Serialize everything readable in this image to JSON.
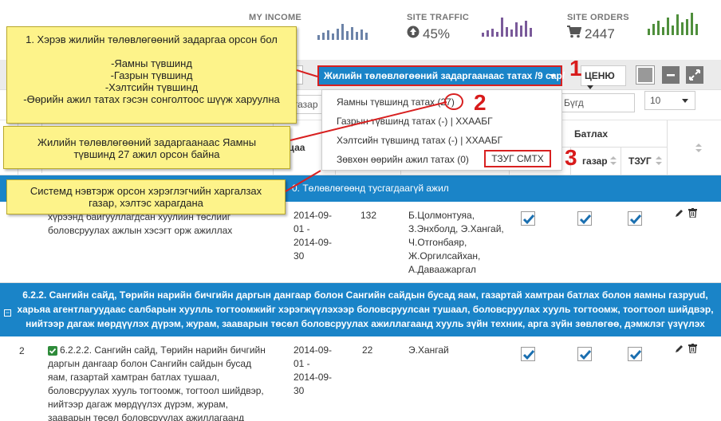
{
  "stats": {
    "income": {
      "label": "MY INCOME"
    },
    "traffic": {
      "label": "SITE TRAFFIC",
      "value": "45%"
    },
    "orders": {
      "label": "SITE ORDERS",
      "value": "2447"
    }
  },
  "colors": {
    "brand_blue": "#1a84c8",
    "annot_yellow": "#fdf38a",
    "annot_red": "#d82020",
    "spark_blue": "#6c83a8",
    "spark_purple": "#7a5a9a",
    "spark_green": "#4f8f3c"
  },
  "toolbar": {
    "dropdown_label": "Жилийн төлөвлөгөөний задаргаанаас татах /9 сар/",
    "menu_label": "ЦЕНЮ"
  },
  "filters": {
    "left_partial": "газар",
    "right_select": "Бүгд",
    "page_size": "10"
  },
  "dropdown_menu": {
    "items": [
      "Яамны түвшинд татах (27)",
      "Газрын түвшинд татах (-) | ХХААБГ",
      "Хэлтсийн түвшинд татах (-) | ХХААБГ",
      "Зөвхөн өөрийн ажил татах (0)"
    ],
    "highlight_label": "ТЗУГ СМТХ"
  },
  "table": {
    "header_date_partial": "тацаа",
    "group_header": "Батлах",
    "col_gazar": "газар",
    "col_tzug": "ТЗУГ"
  },
  "groups": {
    "g1": "0. Төлөвлөгөөнд тусгагдаагүй ажил",
    "g2": "6.2.2. Сангийн сайд, Төрийн нарийн бичгийн даргын дангаар болон Сангийн сайдын бусад яам, газартай хамтран батлах болон яамны газруud, харьяа агентлагуудаас салбарын хуулль тогтоомжийг хэрэгжүүлэхээр боловсруулсан тушаал, боловсруулах хууль тогтоомж, тоогтоол шийдвэр, нийтээр дагаж мөрдүүлэх дүрэм, журам, заавaрын төсөл боловсруулах ажиллагаанд хууль зүйн техник, арга зүйн зөвлөгөө, дэмжлэг үзүүлэх"
  },
  "rows": [
    {
      "desc": "хүрээнд байгууллагдсан хуулийн төслийг боловсруулах ажлын хэсэгт орж ажиллах",
      "date": "2014-09-01 - 2014-09-30",
      "num": "132",
      "people": "Б.Цолмонтуяа, З.Энхболд, Э.Хангай, Ч.Отгонбаяр, Ж.Оргилсайхан, А.Даваажаргал"
    },
    {
      "num_idx": "2",
      "desc": "6.2.2.2. Сангийн сайд, Төрийн нарийн бичгийн даргын дангаар болон Сангийн сайдын бусад яам, газартай хамтран батлах тушаал, боловсруулах хууль тогтоомж, тогтоол шийдвэр, нийтээр дагаж мөрдүүлэх дүрэм, журам, заавaрын төсөл боловсруулах ажиллагаанд",
      "date": "2014-09-01 - 2014-09-30",
      "num": "22",
      "people": "Э.Хангай"
    }
  ],
  "annotations": {
    "note1": "1. Хэрэв жилийн төлөвлөгөөний задаргаа орсон бол\n\n-Яамны түвшинд\n-Газрын түвшинд\n-Хэлтсийн түвшинд\n-Өөрийн ажил татах гэсэн сонголтоос шүүж харуулна",
    "note2": "Жилийн төлөвлөгөөний задаргаанаас Яамны түвшинд 27 ажил орсон байна",
    "note3": "Системд нэвтэрж орсон хэрэглэгчийн харгалзах газар, хэлтэс харагдана",
    "num1": "1",
    "num2": "2",
    "num3": "3"
  }
}
